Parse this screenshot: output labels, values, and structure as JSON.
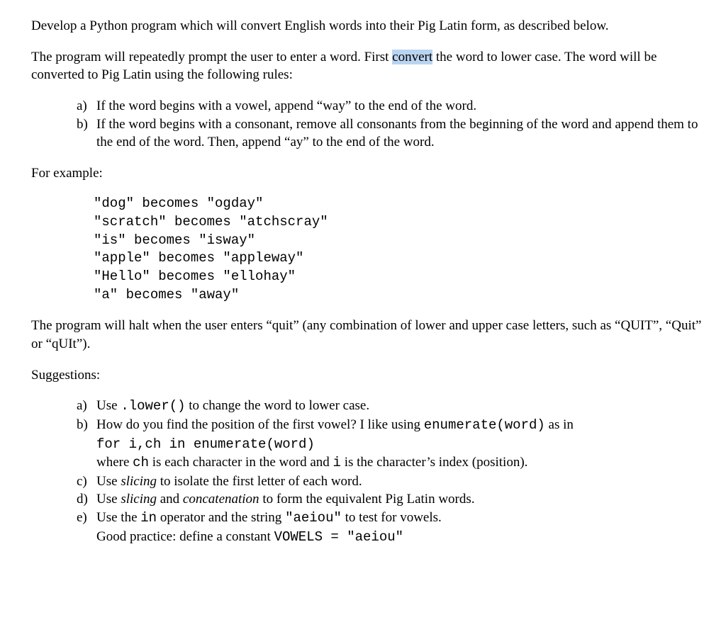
{
  "intro": "Develop a Python program which will convert English words into their Pig Latin form, as described below.",
  "p2_a": "The program will repeatedly prompt the user to enter a word.  First ",
  "p2_hl": "convert",
  "p2_b": " the word to lower case. The word will be converted to Pig Latin using the following rules:",
  "rules": {
    "a_label": "a)",
    "a_text": "If the word begins with a vowel, append “way” to the end of the word.",
    "b_label": "b)",
    "b_text": "If the word begins with a consonant, remove all consonants from the beginning of the word and append them to the end of the word.  Then, append “ay” to the end of the word."
  },
  "for_example": "For example:",
  "examples": [
    "\"dog\" becomes \"ogday\"",
    "\"scratch\" becomes \"atchscray\"",
    "\"is\" becomes \"isway\"",
    "\"apple\" becomes \"appleway\"",
    "\"Hello\" becomes \"ellohay\"",
    "\"a\" becomes \"away\""
  ],
  "halt": "The program will halt when the user enters “quit” (any combination of lower and upper case letters, such as “QUIT”, “Quit” or “qUIt”).",
  "suggestions_heading": "Suggestions:",
  "sug": {
    "a_label": "a)",
    "a_t1": "Use ",
    "a_code": ".lower()",
    "a_t2": " to change the word to lower case.",
    "b_label": "b)",
    "b_t1": "How do you find the position of the first vowel?  I like using ",
    "b_code1": "enumerate(word)",
    "b_t2": " as in",
    "b_code2": "for i,ch in enumerate(word)",
    "b_t3a": "where ",
    "b_ch": "ch",
    "b_t3b": " is each character in the word and ",
    "b_i": "i",
    "b_t3c": " is the character’s index (position).",
    "c_label": "c)",
    "c_t1": "Use ",
    "c_i1": "slicing",
    "c_t2": " to isolate the first letter of each word.",
    "d_label": "d)",
    "d_t1": "Use ",
    "d_i1": "slicing",
    "d_t2": " and ",
    "d_i2": "concatenation",
    "d_t3": " to form the equivalent Pig Latin words.",
    "e_label": "e)",
    "e_t1": "Use the ",
    "e_code1": "in",
    "e_t2": " operator and the string ",
    "e_code2": "\"aeiou\"",
    "e_t3": "  to test for vowels.",
    "e_t4": "Good practice: define a constant ",
    "e_code3": "VOWELS = \"aeiou\""
  }
}
